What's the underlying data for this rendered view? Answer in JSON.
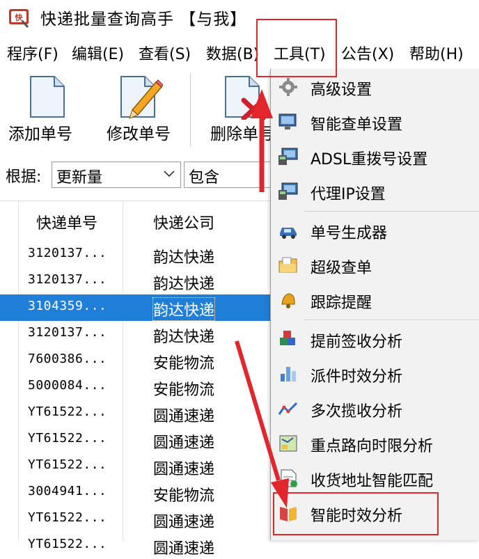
{
  "window": {
    "title": "快递批量查询高手 【与我】"
  },
  "menubar": {
    "items": [
      {
        "label": "程序(F)"
      },
      {
        "label": "编辑(E)"
      },
      {
        "label": "查看(S)"
      },
      {
        "label": "数据(B)"
      },
      {
        "label": "工具(T)"
      },
      {
        "label": "公告(X)"
      },
      {
        "label": "帮助(H)"
      }
    ]
  },
  "toolbar": {
    "add_label": "添加单号",
    "edit_label": "修改单号",
    "delete_label": "删除单号"
  },
  "filter": {
    "label": "根据:",
    "field_value": "更新量",
    "op_value": "包含"
  },
  "grid": {
    "columns": [
      "快递单号",
      "快递公司"
    ],
    "rows": [
      {
        "no": "3120137...",
        "company": "韵达快递"
      },
      {
        "no": "3120137...",
        "company": "韵达快递"
      },
      {
        "no": "3104359...",
        "company": "韵达快递"
      },
      {
        "no": "3120137...",
        "company": "韵达快递"
      },
      {
        "no": "7600386...",
        "company": "安能物流"
      },
      {
        "no": "5000084...",
        "company": "安能物流"
      },
      {
        "no": "YT61522...",
        "company": "圆通速递"
      },
      {
        "no": "YT61522...",
        "company": "圆通速递"
      },
      {
        "no": "YT61522...",
        "company": "圆通速递"
      },
      {
        "no": "3004941...",
        "company": "安能物流"
      },
      {
        "no": "YT61522...",
        "company": "圆通速递"
      },
      {
        "no": "YT61522...",
        "company": "圆通速递"
      }
    ],
    "selected_row": 3
  },
  "tools_menu": {
    "items": [
      {
        "label": "高级设置",
        "icon": "gear-icon"
      },
      {
        "label": "智能查单设置",
        "icon": "monitor-icon"
      },
      {
        "label": "ADSL重拨号设置",
        "icon": "monitor-network-icon"
      },
      {
        "label": "代理IP设置",
        "icon": "monitor-network-icon"
      },
      {
        "label": "单号生成器",
        "icon": "car-icon"
      },
      {
        "label": "超级查单",
        "icon": "folder-icon"
      },
      {
        "label": "跟踪提醒",
        "icon": "bell-icon"
      },
      {
        "label": "提前签收分析",
        "icon": "cubes-icon"
      },
      {
        "label": "派件时效分析",
        "icon": "bar-chart-icon"
      },
      {
        "label": "多次揽收分析",
        "icon": "line-chart-icon"
      },
      {
        "label": "重点路向时限分析",
        "icon": "map-icon"
      },
      {
        "label": "收货地址智能匹配",
        "icon": "document-icon"
      },
      {
        "label": "智能时效分析",
        "icon": "book-icon"
      }
    ]
  },
  "colors": {
    "selection": "#1f7fd8",
    "annotation_red": "#e2262b",
    "menu_bg": "#f2f2f2",
    "menu_highlight": "#cce4f7"
  }
}
